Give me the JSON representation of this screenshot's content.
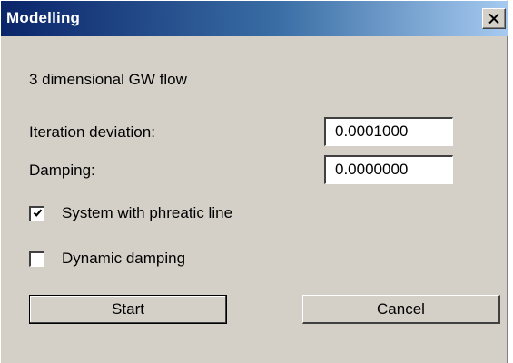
{
  "window": {
    "title": "Modelling",
    "close_icon": "close-icon"
  },
  "content": {
    "subtitle": "3 dimensional GW flow",
    "iteration_label": "Iteration deviation:",
    "iteration_value": "0.0001000",
    "damping_label": "Damping:",
    "damping_value": "0.0000000",
    "phreatic_label": "System with phreatic line",
    "phreatic_checked": true,
    "dynamic_label": "Dynamic damping",
    "dynamic_checked": false
  },
  "buttons": {
    "start_label": "Start",
    "cancel_label": "Cancel"
  },
  "colors": {
    "titlebar_start": "#0a246a",
    "titlebar_end": "#a6caf0",
    "dialog_face": "#d4d0c8"
  }
}
